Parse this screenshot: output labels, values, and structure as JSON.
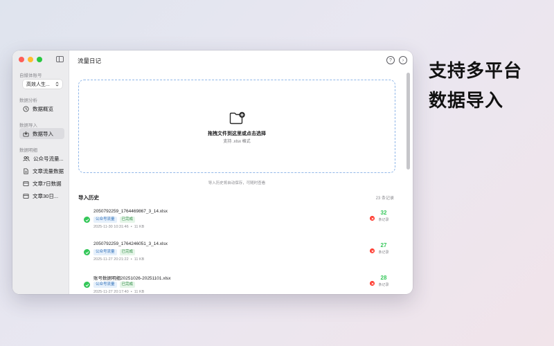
{
  "promo": {
    "line1": "支持多平台",
    "line2": "数据导入"
  },
  "window": {
    "title": "流量日记"
  },
  "sidebar": {
    "account_label": "自媒体账号",
    "account_value": "高效人生...",
    "section_analysis": "数据分析",
    "item_overview": "数据概览",
    "section_import": "数据导入",
    "item_import": "数据导入",
    "section_detail": "数据明细",
    "detail_items": [
      "公众号流量...",
      "文章流量数据",
      "文章7日数据",
      "文章30日..."
    ]
  },
  "header": {
    "help_icon": "?",
    "next_icon": "›"
  },
  "dropzone": {
    "title": "拖拽文件到这里或点击选择",
    "subtitle": "支持 .xlsx 格式"
  },
  "hint": "导入历史将自动保存，可随时查看",
  "history": {
    "title": "导入历史",
    "count": "23 条记录",
    "rows": [
      {
        "file": "2050792259_1764469867_3_14.xlsx",
        "tag1": "公众号流量",
        "tag2": "已完成",
        "time": "2025-11-30 10:31:46",
        "size": "11 KB",
        "count": "32",
        "unit": "条记录"
      },
      {
        "file": "2050792259_1764246051_3_14.xlsx",
        "tag1": "公众号流量",
        "tag2": "已完成",
        "time": "2025-11-27 20:21:22",
        "size": "11 KB",
        "count": "27",
        "unit": "条记录"
      },
      {
        "file": "账号数据明细20251026-20251101.xlsx",
        "tag1": "公众号流量",
        "tag2": "已完成",
        "time": "2025-11-27 20:17:40",
        "size": "11 KB",
        "count": "28",
        "unit": "条记录"
      }
    ]
  },
  "colors": {
    "accent": "#34c759",
    "danger": "#ff3b30",
    "dashed_border": "#8fb6e8"
  },
  "icons": [
    "sidebar-toggle-icon",
    "clock-icon",
    "import-icon",
    "users-icon",
    "document-icon",
    "table-icon",
    "folder-add-icon",
    "help-icon",
    "arrow-circle-icon",
    "check-icon",
    "delete-icon"
  ]
}
